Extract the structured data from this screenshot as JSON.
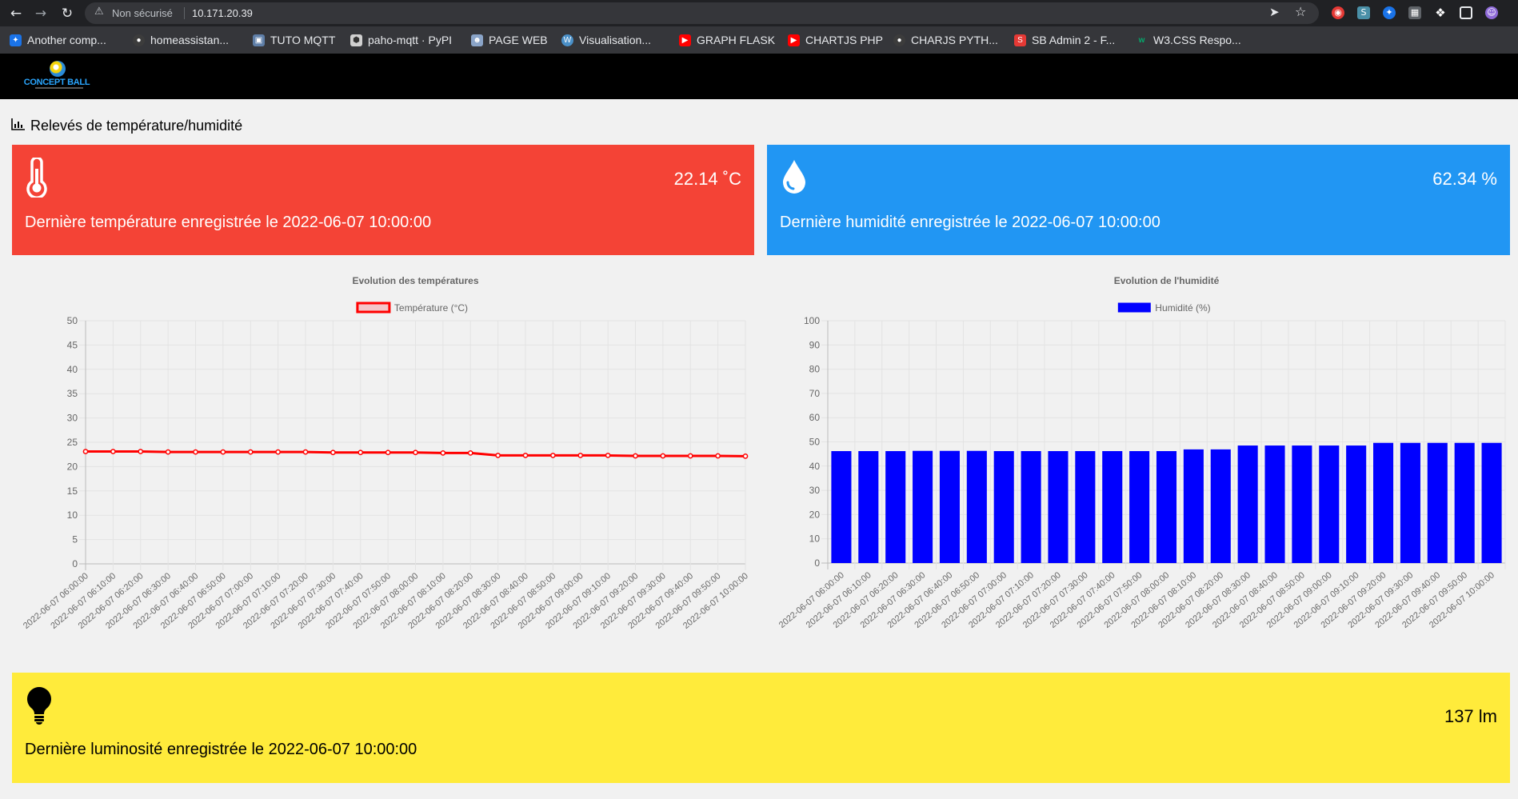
{
  "browser": {
    "security_label": "Non sécurisé",
    "url": "10.171.20.39"
  },
  "bookmarks": [
    {
      "label": "Another comp...",
      "icon": "app-icon",
      "color": "#1a73e8"
    },
    {
      "label": "homeassistan...",
      "icon": "github-icon",
      "color": "#3c3c3c"
    },
    {
      "label": "TUTO MQTT",
      "icon": "page-icon",
      "color": "#5f7fa8"
    },
    {
      "label": "paho-mqtt · PyPI",
      "icon": "cube-icon",
      "color": "#d0d0d0"
    },
    {
      "label": "PAGE WEB",
      "icon": "robot-icon",
      "color": "#8aa4c8"
    },
    {
      "label": "Visualisation...",
      "icon": "wordpress-icon",
      "color": "#4a90c8"
    },
    {
      "label": "GRAPH FLASK",
      "icon": "youtube-icon",
      "color": "#ff0000"
    },
    {
      "label": "CHARTJS PHP",
      "icon": "youtube-icon",
      "color": "#ff0000"
    },
    {
      "label": "CHARJS PYTH...",
      "icon": "github-icon",
      "color": "#3c3c3c"
    },
    {
      "label": "SB Admin 2 - F...",
      "icon": "s-icon",
      "color": "#e53935"
    },
    {
      "label": "W3.CSS Respo...",
      "icon": "w3-icon",
      "color": "#04aa6d"
    }
  ],
  "site": {
    "brand": "CONCEPT BALL",
    "page_title": "Relevés de température/humidité"
  },
  "cards": {
    "temperature": {
      "value": "22.14 ˚C",
      "desc": "Dernière température enregistrée le 2022-06-07 10:00:00",
      "color": "#f44336"
    },
    "humidity": {
      "value": "62.34 %",
      "desc": "Dernière humidité enregistrée le 2022-06-07 10:00:00",
      "color": "#2196f3"
    },
    "luminosity": {
      "value": "137 lm",
      "desc": "Dernière luminosité enregistrée le 2022-06-07 10:00:00",
      "color": "#ffeb3b"
    }
  },
  "chart_data": [
    {
      "type": "line",
      "title": "Evolution des températures",
      "xlabel": "",
      "ylabel": "",
      "ylim": [
        0,
        50
      ],
      "yticks": [
        0,
        5,
        10,
        15,
        20,
        25,
        30,
        35,
        40,
        45,
        50
      ],
      "grid": true,
      "legend": "top",
      "categories": [
        "2022-06-07 06:00:00",
        "2022-06-07 06:10:00",
        "2022-06-07 06:20:00",
        "2022-06-07 06:30:00",
        "2022-06-07 06:40:00",
        "2022-06-07 06:50:00",
        "2022-06-07 07:00:00",
        "2022-06-07 07:10:00",
        "2022-06-07 07:20:00",
        "2022-06-07 07:30:00",
        "2022-06-07 07:40:00",
        "2022-06-07 07:50:00",
        "2022-06-07 08:00:00",
        "2022-06-07 08:10:00",
        "2022-06-07 08:20:00",
        "2022-06-07 08:30:00",
        "2022-06-07 08:40:00",
        "2022-06-07 08:50:00",
        "2022-06-07 09:00:00",
        "2022-06-07 09:10:00",
        "2022-06-07 09:20:00",
        "2022-06-07 09:30:00",
        "2022-06-07 09:40:00",
        "2022-06-07 09:50:00",
        "2022-06-07 10:00:00"
      ],
      "series": [
        {
          "name": "Température (°C)",
          "color": "#ff0000",
          "fill": "#f4c6c9",
          "values": [
            23.1,
            23.1,
            23.1,
            23.0,
            23.0,
            23.0,
            23.0,
            23.0,
            23.0,
            22.9,
            22.9,
            22.9,
            22.9,
            22.8,
            22.8,
            22.3,
            22.3,
            22.3,
            22.3,
            22.3,
            22.2,
            22.2,
            22.2,
            22.2,
            22.14
          ]
        }
      ]
    },
    {
      "type": "bar",
      "title": "Evolution de l'humidité",
      "xlabel": "",
      "ylabel": "",
      "ylim": [
        0,
        100
      ],
      "yticks": [
        0,
        10,
        20,
        30,
        40,
        50,
        60,
        70,
        80,
        90,
        100
      ],
      "grid": true,
      "legend": "top",
      "categories": [
        "2022-06-07 06:00:00",
        "2022-06-07 06:10:00",
        "2022-06-07 06:20:00",
        "2022-06-07 06:30:00",
        "2022-06-07 06:40:00",
        "2022-06-07 06:50:00",
        "2022-06-07 07:00:00",
        "2022-06-07 07:10:00",
        "2022-06-07 07:20:00",
        "2022-06-07 07:30:00",
        "2022-06-07 07:40:00",
        "2022-06-07 07:50:00",
        "2022-06-07 08:00:00",
        "2022-06-07 08:10:00",
        "2022-06-07 08:20:00",
        "2022-06-07 08:30:00",
        "2022-06-07 08:40:00",
        "2022-06-07 08:50:00",
        "2022-06-07 09:00:00",
        "2022-06-07 09:10:00",
        "2022-06-07 09:20:00",
        "2022-06-07 09:30:00",
        "2022-06-07 09:40:00",
        "2022-06-07 09:50:00",
        "2022-06-07 10:00:00"
      ],
      "series": [
        {
          "name": "Humidité (%)",
          "color": "#0000ff",
          "values": [
            46.2,
            46.2,
            46.2,
            46.3,
            46.3,
            46.3,
            46.2,
            46.2,
            46.2,
            46.2,
            46.2,
            46.2,
            46.2,
            46.9,
            46.9,
            48.5,
            48.5,
            48.5,
            48.5,
            48.5,
            49.6,
            49.6,
            49.6,
            49.6,
            49.6
          ]
        }
      ]
    }
  ]
}
